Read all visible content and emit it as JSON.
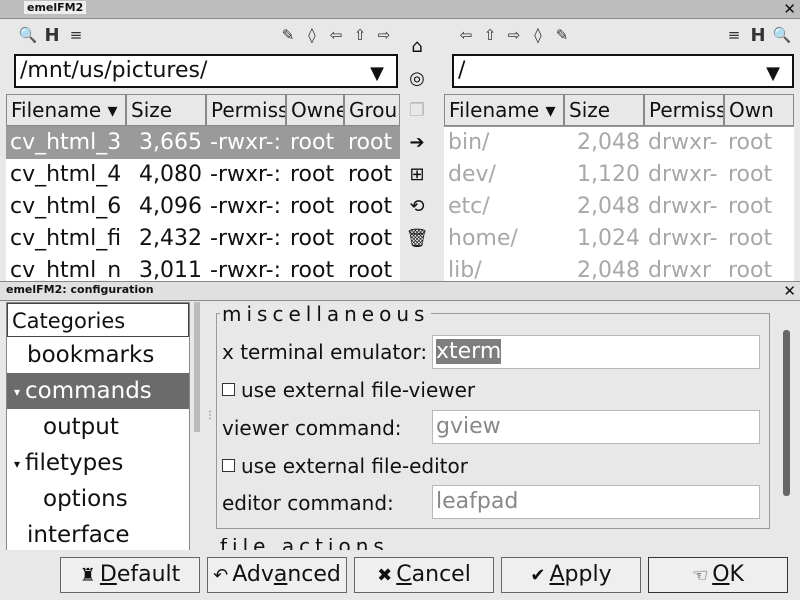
{
  "window": {
    "title": "emelFM2"
  },
  "left_pane": {
    "path": "/mnt/us/pictures/",
    "columns": [
      "Filename",
      "Size",
      "Permiss",
      "Owne",
      "Grou"
    ],
    "rows": [
      {
        "name": "cv_html_3",
        "size": "3,665",
        "perm": "-rwxr-:",
        "owner": "root",
        "group": "root"
      },
      {
        "name": "cv_html_4",
        "size": "4,080",
        "perm": "-rwxr-:",
        "owner": "root",
        "group": "root"
      },
      {
        "name": "cv_html_6",
        "size": "4,096",
        "perm": "-rwxr-:",
        "owner": "root",
        "group": "root"
      },
      {
        "name": "cv_html_fi",
        "size": "2,432",
        "perm": "-rwxr-:",
        "owner": "root",
        "group": "root"
      },
      {
        "name": "cv_html_n",
        "size": "3,011",
        "perm": "-rwxr-:",
        "owner": "root",
        "group": "root"
      }
    ]
  },
  "right_pane": {
    "path": "/",
    "columns": [
      "Filename",
      "Size",
      "Permiss",
      "Own"
    ],
    "rows": [
      {
        "name": "bin/",
        "size": "2,048",
        "perm": "drwxr-",
        "owner": "root"
      },
      {
        "name": "dev/",
        "size": "1,120",
        "perm": "drwxr-",
        "owner": "root"
      },
      {
        "name": "etc/",
        "size": "2,048",
        "perm": "drwxr-",
        "owner": "root"
      },
      {
        "name": "home/",
        "size": "1,024",
        "perm": "drwxr-",
        "owner": "root"
      },
      {
        "name": "lib/",
        "size": "2,048",
        "perm": "drwxr",
        "owner": "root"
      }
    ]
  },
  "config": {
    "title": "emelFM2: configuration",
    "categories_header": "Categories",
    "categories": [
      "bookmarks",
      "commands",
      "output",
      "filetypes",
      "options",
      "interface"
    ],
    "section_title": "miscellaneous",
    "next_section_title": "file actions",
    "terminal_label": "x terminal emulator:",
    "terminal_value": "xterm",
    "use_viewer_label": "use external file-viewer",
    "viewer_label": "viewer command:",
    "viewer_value": "gview",
    "use_editor_label": "use external file-editor",
    "editor_label": "editor command:",
    "editor_value": "leafpad"
  },
  "buttons": {
    "default_u": "D",
    "default_rest": "efault",
    "advanced_pre": "Adv",
    "advanced_u": "a",
    "advanced_rest": "nced",
    "cancel_u": "C",
    "cancel_rest": "ancel",
    "apply_u": "A",
    "apply_rest": "pply",
    "ok_u": "O",
    "ok_rest": "K"
  }
}
